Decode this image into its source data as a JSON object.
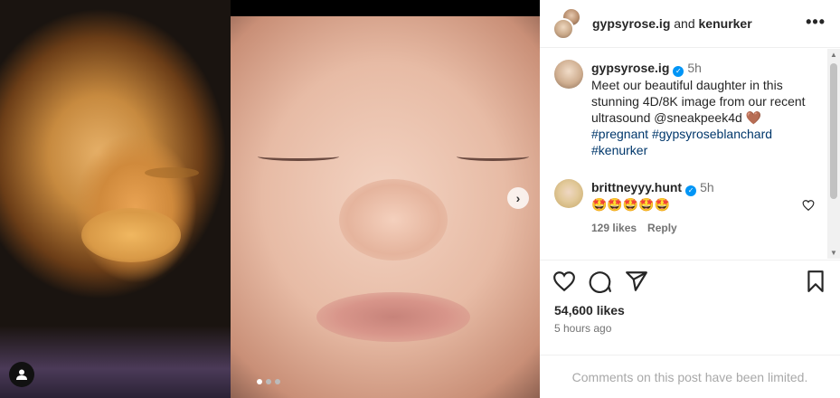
{
  "post": {
    "authors_prefix": "gypsyrose.ig",
    "authors_join": " and ",
    "authors_second": "kenurker",
    "more_label": "•••",
    "carousel_next": "›"
  },
  "caption": {
    "username": "gypsyrose.ig",
    "time": "5h",
    "text": "Meet our beautiful daughter in this stunning 4D/8K image from our recent ultrasound @sneakpeek4d 🤎",
    "hashtags": "#pregnant #gypsyroseblanchard #kenurker"
  },
  "comment": {
    "username": "brittneyyy.hunt",
    "time": "5h",
    "text": "🤩🤩🤩🤩🤩",
    "likes": "129 likes",
    "reply": "Reply"
  },
  "stats": {
    "likes": "54,600 likes",
    "posted": "5 hours ago"
  },
  "footer": {
    "limited": "Comments on this post have been limited."
  },
  "icons": [
    "heart-icon",
    "comment-icon",
    "share-icon",
    "bookmark-icon",
    "user-tag-icon",
    "verified-icon",
    "chevron-right-icon"
  ],
  "colors": {
    "accent": "#0095f6",
    "link": "#00376b",
    "muted": "#737373"
  }
}
